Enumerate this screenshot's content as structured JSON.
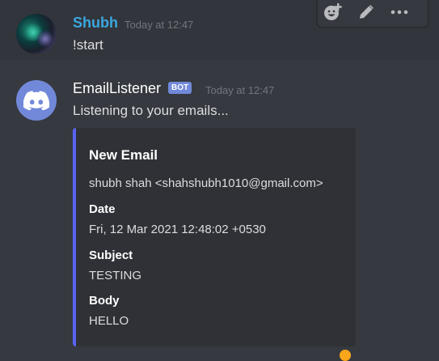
{
  "messages": [
    {
      "username": "Shubh",
      "timestamp": "Today at 12:47",
      "content": "!start"
    },
    {
      "username": "EmailListener",
      "bot_tag": "BOT",
      "timestamp": "Today at 12:47",
      "content": "Listening to your emails...",
      "embed": {
        "title": "New Email",
        "description": "shubh shah <shahshubh1010@gmail.com>",
        "fields": [
          {
            "name": "Date",
            "value": "Fri, 12 Mar 2021 12:48:02 +0530"
          },
          {
            "name": "Subject",
            "value": "TESTING"
          },
          {
            "name": "Body",
            "value": "HELLO"
          }
        ],
        "accent_color": "#5865f2"
      }
    }
  ],
  "toolbar": {
    "icons": [
      "add-reaction-icon",
      "edit-icon",
      "more-options-icon"
    ]
  },
  "colors": {
    "background": "#36393f",
    "hover_background": "#32353b",
    "username_shubh": "#3ba8e0",
    "bot_tag": "#7289da",
    "embed_bg": "#2f3136"
  }
}
